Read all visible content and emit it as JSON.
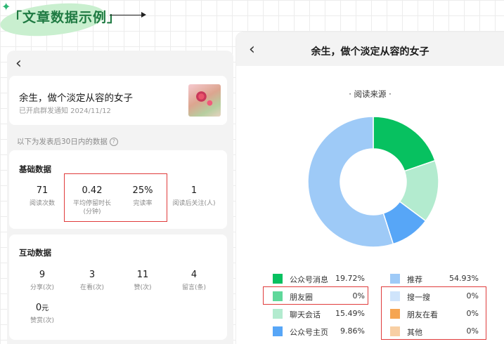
{
  "header": {
    "title": "「文章数据示例」"
  },
  "left": {
    "article": {
      "title": "余生，做个淡定从容的女子",
      "subtitle": "已开启群发通知 2024/11/12"
    },
    "note": "以下为发表后30日内的数据",
    "qmark": "?",
    "basic": {
      "title": "基础数据",
      "stats": [
        {
          "value": "71",
          "label": "阅读次数"
        },
        {
          "value": "0.42",
          "label": "平均停留时长\n(分钟)"
        },
        {
          "value": "25%",
          "label": "完读率"
        },
        {
          "value": "1",
          "label": "阅读后关注(人)"
        }
      ]
    },
    "interact": {
      "title": "互动数据",
      "stats": [
        {
          "value": "9",
          "label": "分享(次)"
        },
        {
          "value": "3",
          "label": "在看(次)"
        },
        {
          "value": "11",
          "label": "赞(次)"
        },
        {
          "value": "4",
          "label": "留言(条)"
        }
      ],
      "reward": {
        "value": "0",
        "unit": "元",
        "label": "赞赏(次)"
      }
    }
  },
  "right": {
    "title": "余生，做个淡定从容的女子",
    "chart_data": {
      "type": "pie",
      "title": "· 阅读来源 ·",
      "series": [
        {
          "name": "公众号消息",
          "value": 19.72,
          "label": "19.72%",
          "color": "#07c160"
        },
        {
          "name": "朋友圈",
          "value": 0,
          "label": "0%",
          "color": "#5fd89a"
        },
        {
          "name": "聊天会话",
          "value": 15.49,
          "label": "15.49%",
          "color": "#b3ebcf"
        },
        {
          "name": "公众号主页",
          "value": 9.86,
          "label": "9.86%",
          "color": "#57a6f7"
        },
        {
          "name": "推荐",
          "value": 54.93,
          "label": "54.93%",
          "color": "#9ecaf7"
        },
        {
          "name": "搜一搜",
          "value": 0,
          "label": "0%",
          "color": "#cfe4fb"
        },
        {
          "name": "朋友在看",
          "value": 0,
          "label": "0%",
          "color": "#f5a552"
        },
        {
          "name": "其他",
          "value": 0,
          "label": "0%",
          "color": "#f8cfa4"
        }
      ],
      "draw_order": [
        0,
        2,
        3,
        4
      ],
      "highlight_color": "#e03b3b"
    }
  }
}
